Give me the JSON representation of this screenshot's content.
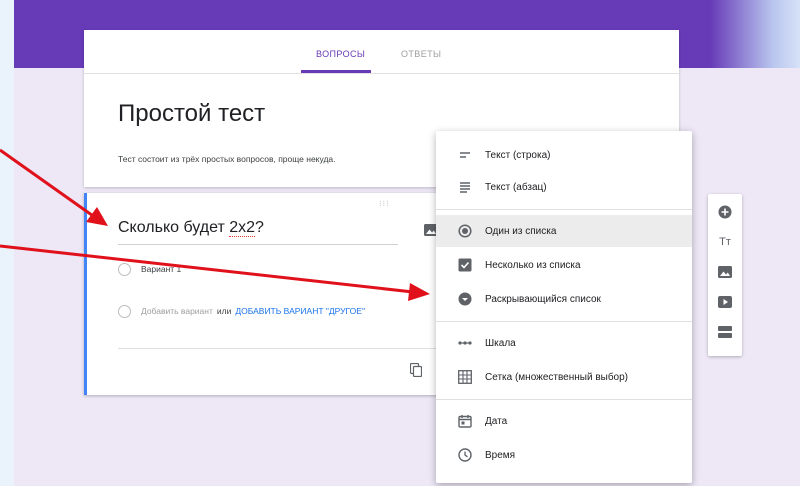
{
  "tabs": {
    "questions": "ВОПРОСЫ",
    "answers": "ОТВЕТЫ"
  },
  "form": {
    "title": "Простой тест",
    "description": "Тест состоит из трёх простых вопросов, проще некуда."
  },
  "question": {
    "title_prefix": "Сколько будет ",
    "title_misspelled": "2х2",
    "title_suffix": "?",
    "option1": "Вариант 1",
    "add_option": "Добавить вариант",
    "or": "или",
    "add_other": "ДОБАВИТЬ ВАРИАНТ \"ДРУГОЕ\""
  },
  "menu": {
    "items": [
      {
        "label": "Текст (строка)",
        "icon": "short-text-icon"
      },
      {
        "label": "Текст (абзац)",
        "icon": "paragraph-icon"
      },
      {
        "label": "Один из списка",
        "icon": "radio-button-icon",
        "selected": true
      },
      {
        "label": "Несколько из списка",
        "icon": "checkbox-icon"
      },
      {
        "label": "Раскрывающийся список",
        "icon": "dropdown-icon"
      },
      {
        "label": "Шкала",
        "icon": "linear-scale-icon"
      },
      {
        "label": "Сетка (множественный выбор)",
        "icon": "grid-icon"
      },
      {
        "label": "Дата",
        "icon": "calendar-icon"
      },
      {
        "label": "Время",
        "icon": "clock-icon"
      }
    ]
  },
  "toolbar": {
    "title_button": "Тт"
  },
  "colors": {
    "brand": "#673ab7",
    "background": "#ede7f6",
    "accent_blue": "#4285f4",
    "link_blue": "#1a73e8",
    "arrow_red": "#e0111b"
  }
}
